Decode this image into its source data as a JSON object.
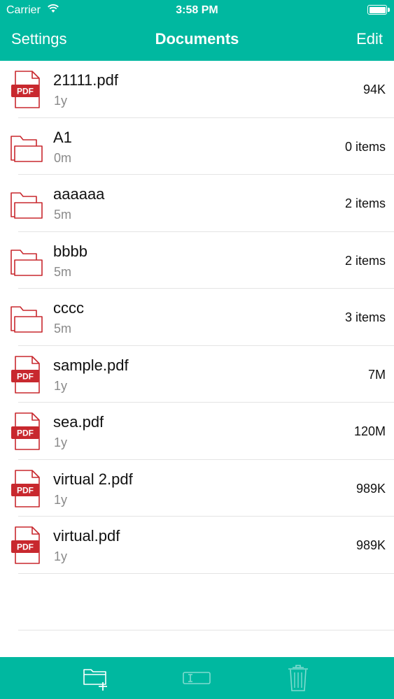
{
  "status_bar": {
    "carrier": "Carrier",
    "time": "3:58 PM"
  },
  "nav": {
    "left": "Settings",
    "title": "Documents",
    "right": "Edit"
  },
  "items": [
    {
      "name": "21111.pdf",
      "age": "1y",
      "size": "94K",
      "type": "pdf"
    },
    {
      "name": "A1",
      "age": "0m",
      "size": "0 items",
      "type": "folder"
    },
    {
      "name": "aaaaaa",
      "age": "5m",
      "size": "2 items",
      "type": "folder"
    },
    {
      "name": "bbbb",
      "age": "5m",
      "size": "2 items",
      "type": "folder"
    },
    {
      "name": "cccc",
      "age": "5m",
      "size": "3 items",
      "type": "folder"
    },
    {
      "name": "sample.pdf",
      "age": "1y",
      "size": "7M",
      "type": "pdf"
    },
    {
      "name": "sea.pdf",
      "age": "1y",
      "size": "120M",
      "type": "pdf"
    },
    {
      "name": "virtual 2.pdf",
      "age": "1y",
      "size": "989K",
      "type": "pdf"
    },
    {
      "name": "virtual.pdf",
      "age": "1y",
      "size": "989K",
      "type": "pdf"
    }
  ],
  "pdf_badge": "PDF",
  "toolbar": {
    "icons": [
      "new-folder-icon",
      "rename-icon",
      "trash-icon"
    ]
  },
  "colors": {
    "accent": "#00b8a0",
    "icon_red": "#c8282e"
  }
}
